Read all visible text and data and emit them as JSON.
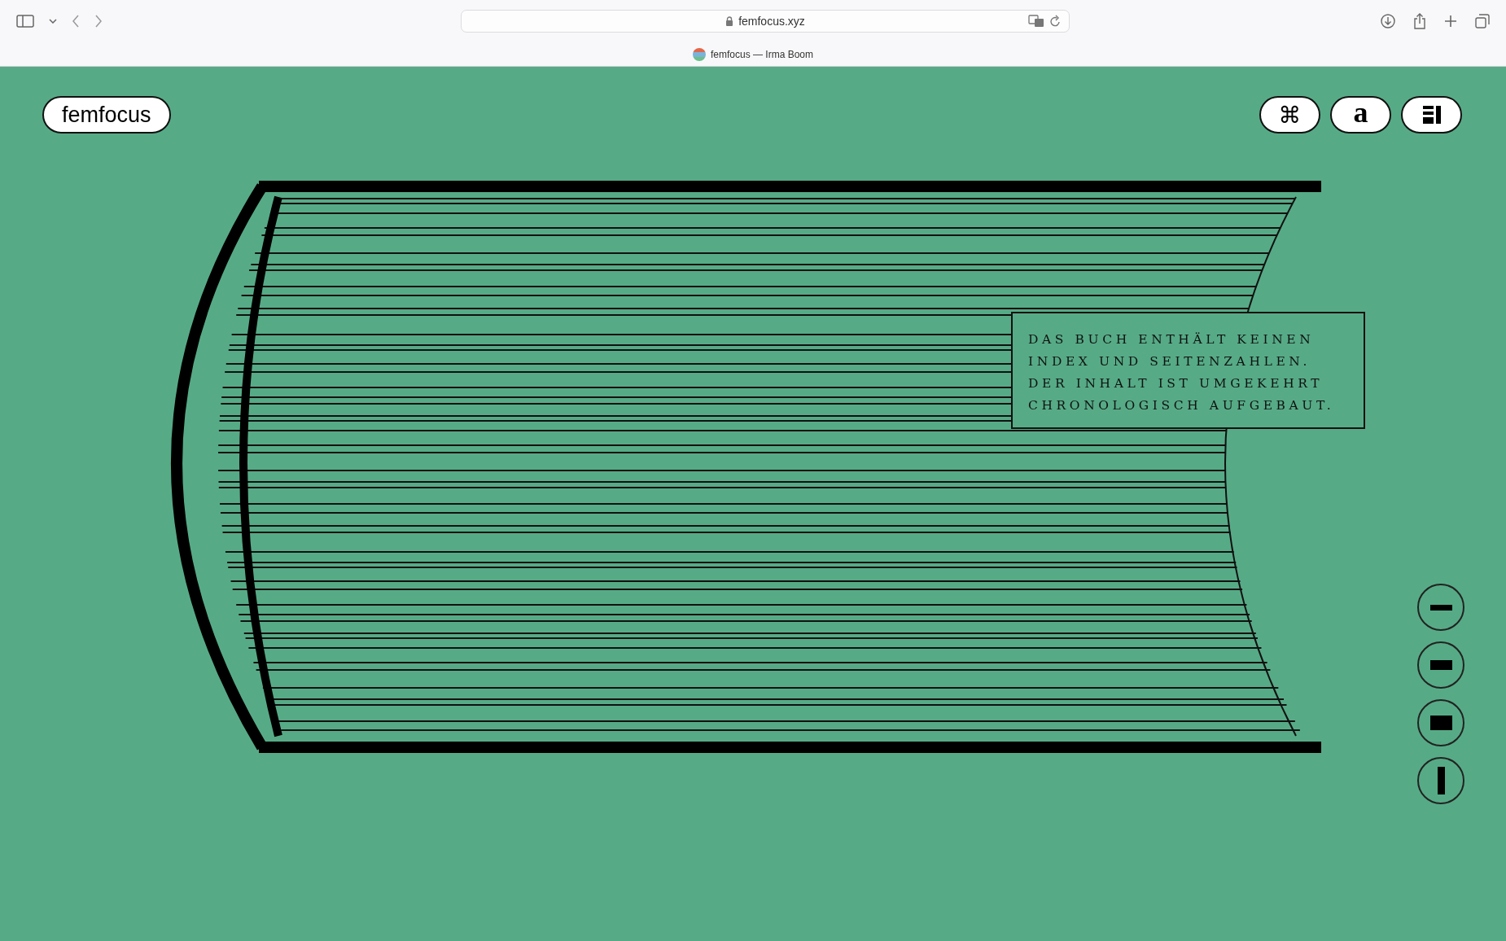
{
  "browser": {
    "url": "femfocus.xyz",
    "tab_title": "femfocus — Irma Boom"
  },
  "header": {
    "logo": "femfocus",
    "buttons": [
      {
        "kind": "command",
        "label": "⌘"
      },
      {
        "kind": "letter",
        "label": "a"
      },
      {
        "kind": "layout"
      }
    ]
  },
  "note": {
    "lines": [
      "DAS BUCH ENTHÄLT KEINEN",
      "INDEX UND SEITENZAHLEN.",
      "DER INHALT IST UMGEKEHRT",
      "CHRONOLOGISCH AUFGEBAUT."
    ]
  },
  "zoom_controls": [
    {
      "kind": "thin"
    },
    {
      "kind": "medium"
    },
    {
      "kind": "thick"
    },
    {
      "kind": "spine"
    }
  ]
}
